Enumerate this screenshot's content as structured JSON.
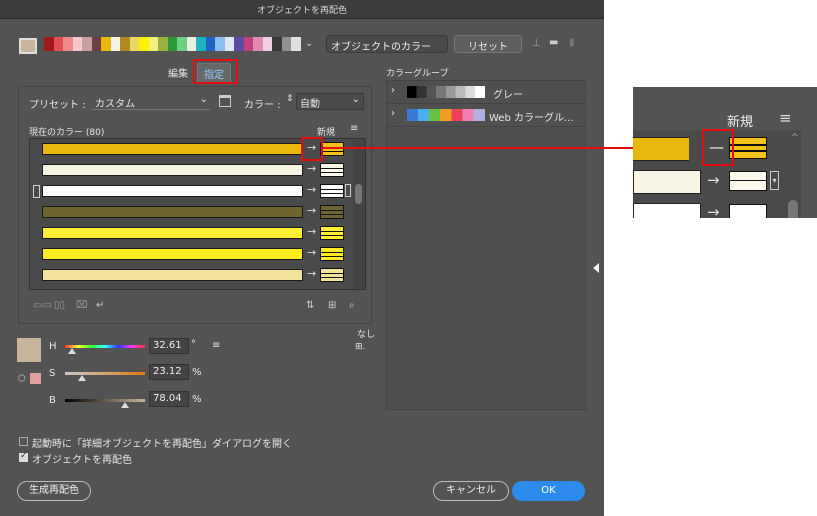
{
  "dialog": {
    "title": "オブジェクトを再配色",
    "object_color_dropdown": "オブジェクトのカラー",
    "reset_button": "リセット",
    "tabs": [
      {
        "label": "編集"
      },
      {
        "label": "指定"
      }
    ],
    "preset_label": "プリセット :",
    "preset_value": "カスタム",
    "color_label": "カラー :",
    "color_value": "自動",
    "current_colors_label": "現在のカラー (80)",
    "new_label": "新規",
    "arrow_glyph": "→",
    "color_groups_label": "カラーグループ",
    "color_groups": [
      {
        "label": "グレー"
      },
      {
        "label": "Web カラーグル..."
      }
    ],
    "none_label": "なし",
    "sliders": [
      {
        "label": "H",
        "value": "32.61",
        "unit": "°"
      },
      {
        "label": "S",
        "value": "23.12",
        "unit": "%"
      },
      {
        "label": "B",
        "value": "78.04",
        "unit": "%"
      }
    ],
    "options": [
      {
        "label": "起動時に「詳細オブジェクトを再配色」ダイアログを開く",
        "checked": false
      },
      {
        "label": "オブジェクトを再配色",
        "checked": true
      }
    ],
    "generate_button": "生成再配色",
    "cancel_button": "キャンセル",
    "ok_button": "OK"
  },
  "color_rows": [
    {
      "current": "#e8b80c",
      "new": "#f2c21a"
    },
    {
      "current": "#f8f4e4",
      "new": "#fbf8ec"
    },
    {
      "current": "#ffffff",
      "new": "#ffffff"
    },
    {
      "current": "#6e6430",
      "new": "#6e6430"
    },
    {
      "current": "#fff033",
      "new": "#fff033"
    },
    {
      "current": "#ffec20",
      "new": "#ffec20"
    },
    {
      "current": "#f1e49a",
      "new": "#f1e49a"
    },
    {
      "current": "#fff000",
      "new": "#fff000"
    }
  ],
  "zoom_inset": {
    "new_label": "新規",
    "arrow_glyph": "→",
    "dash_glyph": "—"
  },
  "colors": {
    "dialog_bg": "#535353",
    "highlight": "#e01010",
    "ok_blue": "#2d8ceb"
  }
}
